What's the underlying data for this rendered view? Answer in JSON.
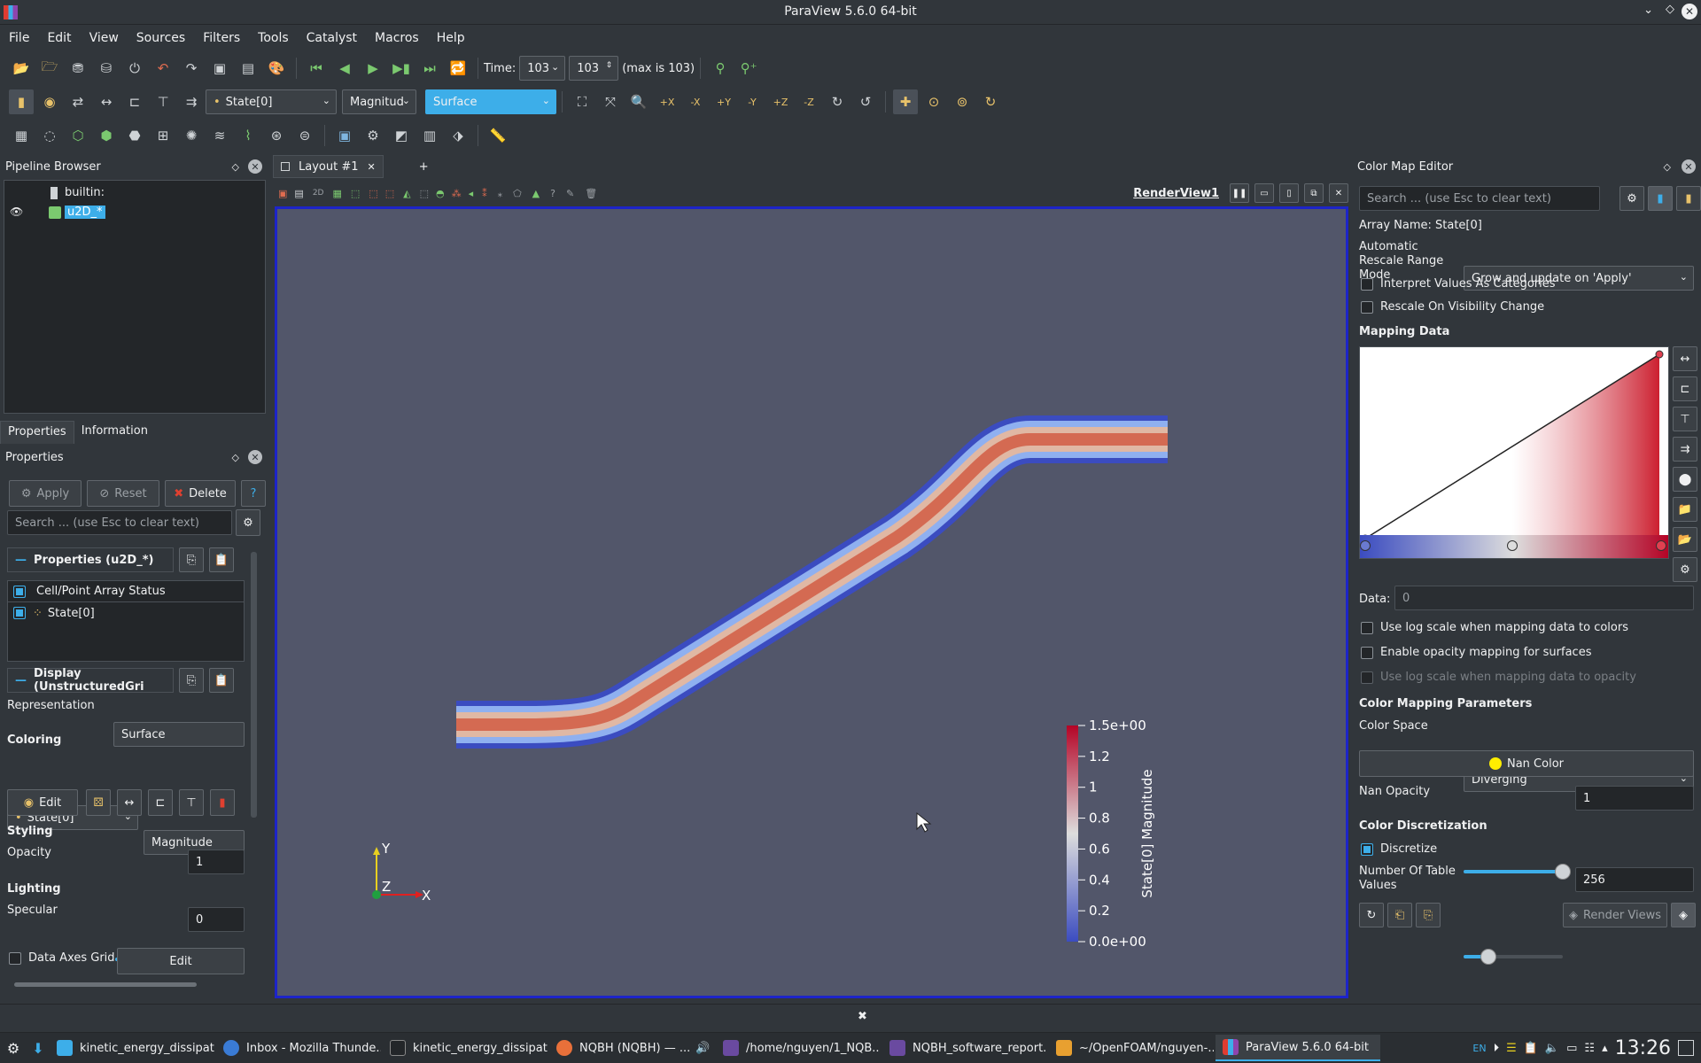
{
  "window": {
    "title": "ParaView 5.6.0 64-bit"
  },
  "menu": [
    "File",
    "Edit",
    "View",
    "Sources",
    "Filters",
    "Tools",
    "Catalyst",
    "Macros",
    "Help"
  ],
  "time": {
    "label": "Time:",
    "value": "103",
    "step": "103",
    "max_label": "(max is 103)"
  },
  "toolbar2": {
    "array": "State[0]",
    "component": "Magnitud",
    "representation": "Surface"
  },
  "pipeline": {
    "title": "Pipeline Browser",
    "root": "builtin:",
    "source": "u2D_*"
  },
  "tabs": {
    "properties": "Properties",
    "information": "Information"
  },
  "properties": {
    "title": "Properties",
    "apply": "Apply",
    "reset": "Reset",
    "delete": "Delete",
    "help": "?",
    "search_placeholder": "Search ... (use Esc to clear text)",
    "group1": "Properties (u2D_*)",
    "array_status": "Cell/Point Array Status",
    "array_item": "State[0]",
    "group2": "Display (UnstructuredGri",
    "representation_label": "Representation",
    "representation_value": "Surface",
    "coloring": "Coloring",
    "color_array": "State[0]",
    "color_component": "Magnitude",
    "edit": "Edit",
    "styling": "Styling",
    "opacity_label": "Opacity",
    "opacity_value": "1",
    "opacity_level": 1.0,
    "lighting": "Lighting",
    "specular_label": "Specular",
    "specular_value": "0",
    "specular_level": 0.0,
    "axes_grid": "Data Axes Grid",
    "axes_edit": "Edit"
  },
  "layout": {
    "tab": "Layout #1",
    "add": "+",
    "view": "RenderView1"
  },
  "render": {
    "background": "#52566a",
    "axes": {
      "y": "Y",
      "z": "Z",
      "x": "X"
    },
    "colorbar": {
      "title": "State[0] Magnitude",
      "ticks": [
        "1.5e+00",
        "1.2",
        "1",
        "0.8",
        "0.6",
        "0.4",
        "0.2",
        "0.0e+00"
      ],
      "range": [
        0,
        1.5
      ]
    }
  },
  "cme": {
    "title": "Color Map Editor",
    "search_placeholder": "Search ... (use Esc to clear text)",
    "array_name": "Array Name: State[0]",
    "rescale_label": "Automatic Rescale Range Mode",
    "rescale_value": "Grow and update on 'Apply'",
    "interpret": "Interpret Values As Categories",
    "rescale_vis": "Rescale On Visibility Change",
    "mapping": "Mapping Data",
    "data_label": "Data:",
    "data_value": "0",
    "log_colors": "Use log scale when mapping data to colors",
    "opacity_surfaces": "Enable opacity mapping for surfaces",
    "log_opacity": "Use log scale when mapping data to opacity",
    "params": "Color Mapping Parameters",
    "space_label": "Color Space",
    "space_value": "Diverging",
    "nan_color": "Nan Color",
    "nan_opacity_label": "Nan Opacity",
    "nan_opacity_value": "1",
    "nan_opacity_level": 1.0,
    "discretization": "Color Discretization",
    "discretize": "Discretize",
    "table_values_label": "Number Of Table Values",
    "table_values": "256",
    "table_level": 0.25,
    "render_views": "Render Views"
  },
  "taskbar": {
    "items": [
      "kinetic_energy_dissipat...",
      "Inbox - Mozilla Thunde...",
      "kinetic_energy_dissipat...",
      "NQBH (NQBH) — ...",
      "/home/nguyen/1_NQB...",
      "NQBH_software_report...",
      "~/OpenFOAM/nguyen-...",
      "ParaView 5.6.0 64-bit"
    ],
    "lang": "EN",
    "clock": "13:26"
  },
  "colors": {
    "accent": "#3daee9",
    "cold": "#3b4cc0",
    "warm": "#b40426",
    "mid": "#dddddd"
  }
}
